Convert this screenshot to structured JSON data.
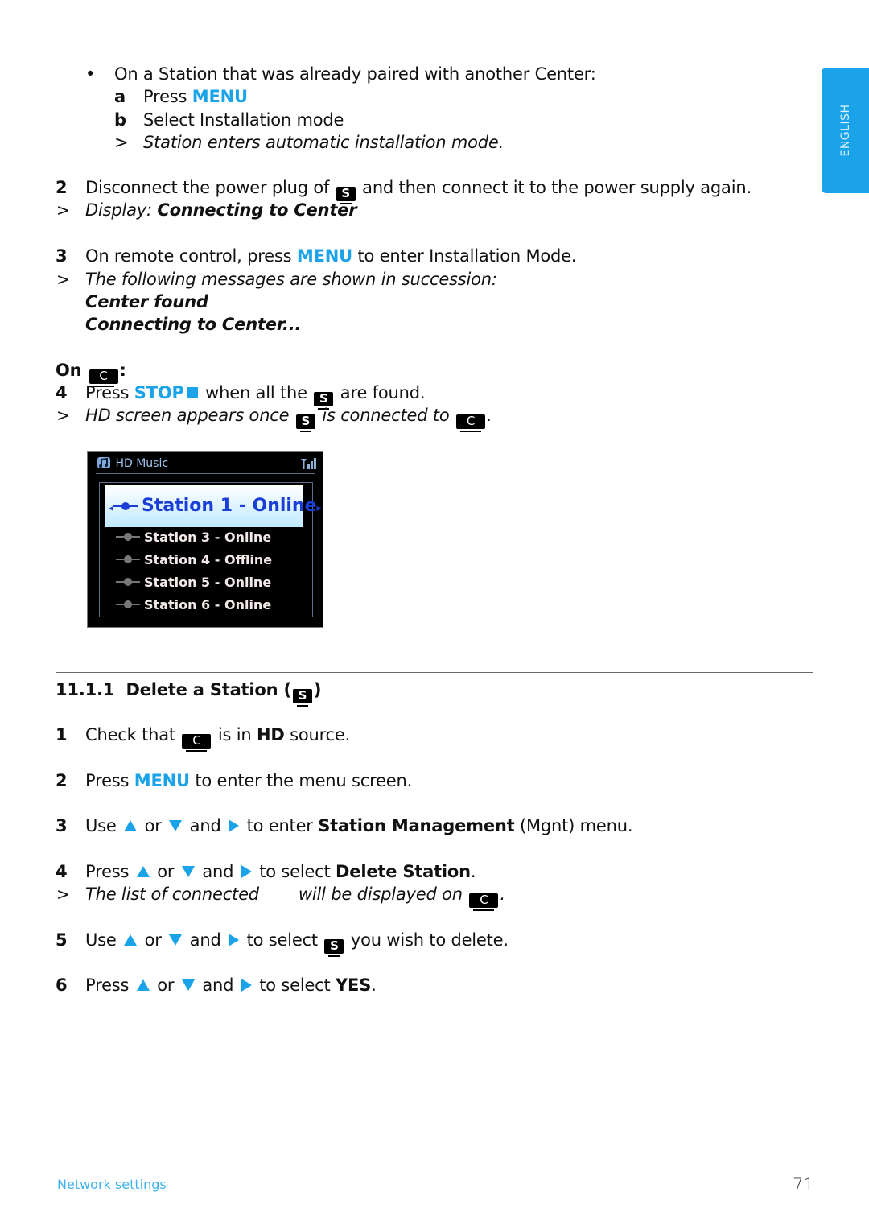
{
  "side_tab": {
    "label": "ENGLISH",
    "color": "#1aa3e8"
  },
  "accent_color": "#1aa3e8",
  "intro": {
    "bullet": "•",
    "bullet_text": "On a Station that was already paired with another Center:",
    "sub_a_letter": "a",
    "sub_a_text": "Press",
    "sub_a_key": "MENU",
    "sub_b_letter": "b",
    "sub_b_text": "Select Installation mode",
    "result_marker": ">",
    "result_text": "Station enters automatic installation mode."
  },
  "step2": {
    "num": "2",
    "text_before": "Disconnect the power plug of",
    "device": "S",
    "text_after": "and then connect it to the power supply again.",
    "result_marker": ">",
    "result_label": "Display:",
    "result_bold": "Connecting to Center"
  },
  "step3": {
    "num": "3",
    "text_before": "On remote control, press",
    "key": "MENU",
    "text_after": "to enter Installation Mode.",
    "result_marker": ">",
    "result_text": "The following messages are shown in succession:",
    "message1": "Center found",
    "message2": "Connecting to Center..."
  },
  "on_center": {
    "label": "On",
    "device": "C",
    "colon": ":"
  },
  "step4": {
    "num": "4",
    "text_before": "Press",
    "key": "STOP",
    "text_mid": "when all the",
    "device": "S",
    "text_after": "are found.",
    "result_marker": ">",
    "result_before": "HD screen appears once",
    "result_device1": "S",
    "result_mid": "is connected to",
    "result_device2": "C",
    "result_end": "."
  },
  "hd_screen": {
    "title": "HD Music",
    "selected": "Station 1 - Online",
    "rows": [
      {
        "label": "Station 3 - Online",
        "status": "online"
      },
      {
        "label": "Station 4 - Offline",
        "status": "offline"
      },
      {
        "label": "Station 5 - Online",
        "status": "online"
      },
      {
        "label": "Station 6 - Online",
        "status": "online"
      }
    ]
  },
  "section": {
    "number": "11.1.1",
    "title": "Delete a Station (",
    "device": "S",
    "title_end": ")"
  },
  "delete_steps": {
    "s1": {
      "num": "1",
      "before": "Check that",
      "device": "C",
      "mid": "is in",
      "bold": "HD",
      "after": "source."
    },
    "s2": {
      "num": "2",
      "before": "Press",
      "key": "MENU",
      "after": "to enter the menu screen."
    },
    "s3": {
      "num": "3",
      "before": "Use",
      "or": "or",
      "and": "and",
      "to": "to enter",
      "bold": "Station Management",
      "after": "(Mgnt) menu."
    },
    "s4": {
      "num": "4",
      "before": "Press",
      "or": "or",
      "and": "and",
      "to": "to select",
      "bold": "Delete Station",
      "after": ".",
      "result_marker": ">",
      "result_before": "The list of connected",
      "result_after": "will be displayed on",
      "result_device": "C",
      "result_end": "."
    },
    "s5": {
      "num": "5",
      "before": "Use",
      "or": "or",
      "and": "and",
      "to": "to select",
      "device": "S",
      "after": "you wish to delete."
    },
    "s6": {
      "num": "6",
      "before": "Press",
      "or": "or",
      "and": "and",
      "to": "to select",
      "bold": "YES",
      "after": "."
    }
  },
  "footer": {
    "section_name": "Network settings",
    "page_number": "71"
  }
}
